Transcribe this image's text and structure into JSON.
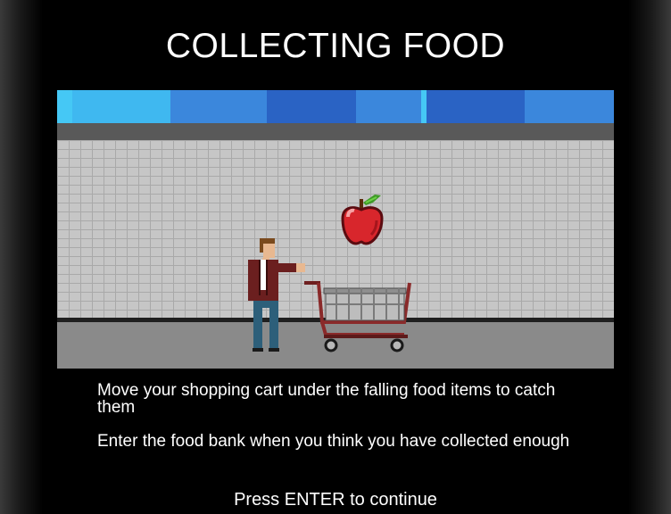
{
  "screen": {
    "title": "COLLECTING FOOD",
    "instructions": [
      "Move your shopping cart under the falling food items to catch them",
      "Enter the food bank when you think you have collected enough"
    ],
    "continue_prompt": "Press ENTER to continue"
  },
  "scene": {
    "sky_colors": [
      "#45c8f5",
      "#3b87dc",
      "#2a63c4",
      "#3b87dc",
      "#2a63c4",
      "#3b87dc"
    ],
    "wall_color": "#c6c6c6",
    "street_color": "#8a8a8a",
    "sprites": {
      "falling_item": "apple-icon",
      "player": "shopper-character",
      "cart": "shopping-cart-icon"
    }
  }
}
